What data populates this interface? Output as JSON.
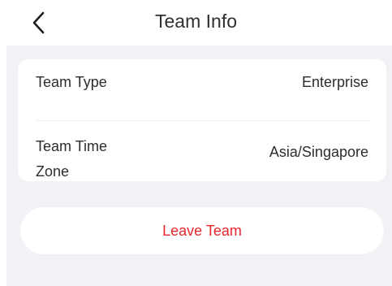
{
  "header": {
    "title": "Team Info",
    "back_icon": "chevron-left-icon"
  },
  "team_info": {
    "rows": [
      {
        "label": "Team Type",
        "value": "Enterprise"
      },
      {
        "label": "Team Time Zone",
        "value": "Asia/Singapore"
      }
    ]
  },
  "actions": {
    "leave_label": "Leave Team"
  },
  "colors": {
    "background": "#f1f1f6",
    "card": "#ffffff",
    "danger": "#e8262c",
    "text": "#2d2d2d"
  }
}
